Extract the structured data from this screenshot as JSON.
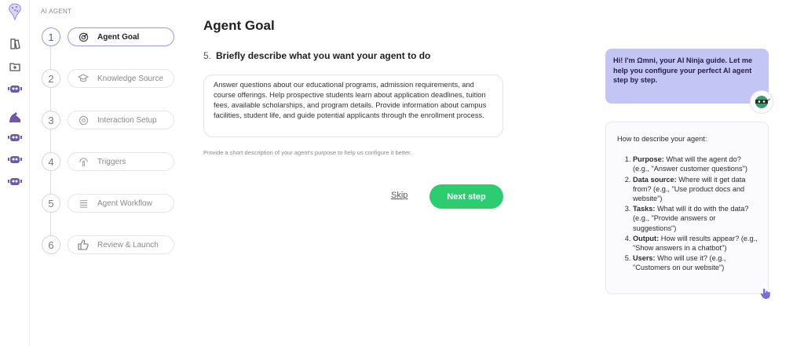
{
  "rail": {
    "icons": [
      "brain-logo-icon",
      "book-icon",
      "add-folder-icon",
      "robot-icon",
      "arm-icon",
      "robot-icon",
      "robot-icon",
      "robot-icon"
    ]
  },
  "stepper": {
    "section_label": "AI AGENT",
    "steps": [
      {
        "num": "1",
        "label": "Agent Goal",
        "icon": "target-icon",
        "active": true
      },
      {
        "num": "2",
        "label": "Knowledge Source",
        "icon": "graduation-cap-icon",
        "active": false
      },
      {
        "num": "3",
        "label": "Interaction Setup",
        "icon": "gear-icon",
        "active": false
      },
      {
        "num": "4",
        "label": "Triggers",
        "icon": "tap-icon",
        "active": false
      },
      {
        "num": "5",
        "label": "Agent Workflow",
        "icon": "workflow-icon",
        "active": false
      },
      {
        "num": "6",
        "label": "Review & Launch",
        "icon": "thumbs-up-icon",
        "active": false
      }
    ]
  },
  "main": {
    "title": "Agent Goal",
    "question_num": "5.",
    "question": "Briefly describe what you want your agent to do",
    "description": "Answer questions about our educational programs, admission requirements, and course offerings. Help prospective students learn about application deadlines, tuition fees, available scholarships, and program details. Provide information about campus facilities, student life, and guide potential applicants through the enrollment process.",
    "hint": "Provide a short description of your agent's purpose to help us configure it better.",
    "skip_label": "Skip",
    "next_label": "Next step"
  },
  "assistant": {
    "greeting": "Hi! I'm Ωmni, your AI Ninja guide. Let me help you configure your perfect AI agent step by step.",
    "help_intro": "How to describe your agent:",
    "tips": [
      {
        "term": "Purpose:",
        "text": " What will the agent do? (e.g., \"Answer customer questions\")"
      },
      {
        "term": "Data source:",
        "text": " Where will it get data from? (e.g., \"Use product docs and website\")"
      },
      {
        "term": "Tasks:",
        "text": " What will it do with the data? (e.g., \"Provide answers or suggestions\")"
      },
      {
        "term": "Output:",
        "text": " How will results appear? (e.g., \"Show answers in a chatbot\")"
      },
      {
        "term": "Users:",
        "text": " Who will use it? (e.g., \"Customers on our website\")"
      }
    ]
  },
  "colors": {
    "accent": "#9b96e0",
    "primary_button": "#2ecc71",
    "bubble": "#c3c6f5"
  }
}
